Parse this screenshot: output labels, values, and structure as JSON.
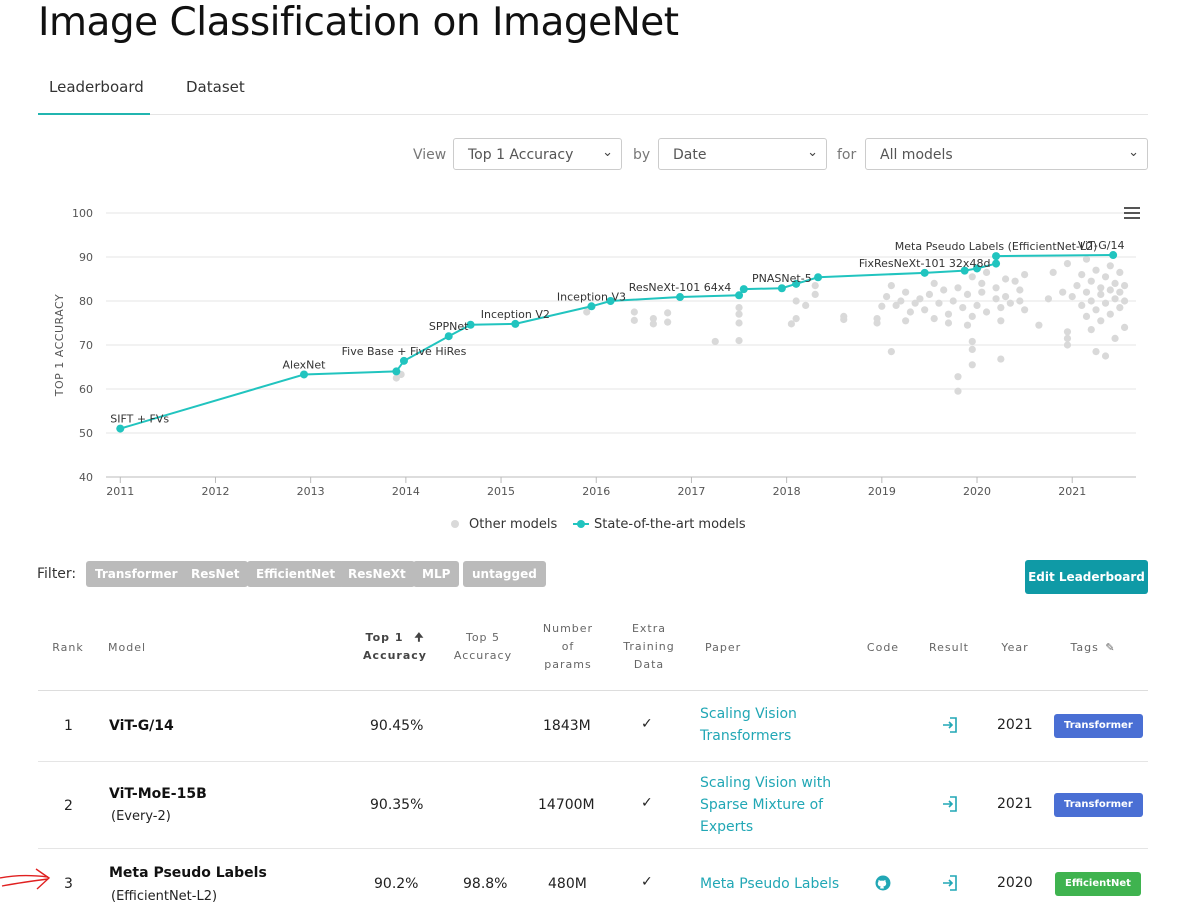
{
  "page": {
    "title": "Image Classification on ImageNet"
  },
  "tabs": [
    {
      "label": "Leaderboard"
    },
    {
      "label": "Dataset"
    }
  ],
  "viewbar": {
    "view_label": "View",
    "view_value": "Top 1 Accuracy",
    "by_label": "by",
    "by_value": "Date",
    "for_label": "for",
    "for_value": "All models"
  },
  "chart_data": {
    "type": "scatter",
    "ylabel": "TOP 1 ACCURACY",
    "ylim": [
      40,
      100
    ],
    "yticks": [
      "40",
      "50",
      "60",
      "70",
      "80",
      "90",
      "100"
    ],
    "xlim": [
      2010.85,
      2021.67
    ],
    "xticks": [
      "2011",
      "2012",
      "2013",
      "2014",
      "2015",
      "2016",
      "2017",
      "2018",
      "2019",
      "2020",
      "2021"
    ],
    "grid": true,
    "legend_placement": "bottom",
    "legend": [
      "Other models",
      "State-of-the-art models"
    ],
    "colors": {
      "sota": "#21c4bf",
      "other": "#d9d9d9"
    },
    "sota_series": {
      "name": "State-of-the-art models",
      "points": [
        {
          "x": 2011.0,
          "y": 51.0,
          "label": "SIFT + FVs"
        },
        {
          "x": 2012.93,
          "y": 63.3,
          "label": "AlexNet"
        },
        {
          "x": 2013.9,
          "y": 64.0,
          "label": ""
        },
        {
          "x": 2013.98,
          "y": 66.4,
          "label": "Five Base + Five HiRes"
        },
        {
          "x": 2014.45,
          "y": 72.0,
          "label": "SPPNet"
        },
        {
          "x": 2014.68,
          "y": 74.6,
          "label": ""
        },
        {
          "x": 2015.15,
          "y": 74.8,
          "label": "Inception V2"
        },
        {
          "x": 2015.95,
          "y": 78.8,
          "label": "Inception V3"
        },
        {
          "x": 2016.15,
          "y": 80.0,
          "label": ""
        },
        {
          "x": 2016.88,
          "y": 80.9,
          "label": "ResNeXt-101 64x4"
        },
        {
          "x": 2017.5,
          "y": 81.3,
          "label": ""
        },
        {
          "x": 2017.55,
          "y": 82.7,
          "label": ""
        },
        {
          "x": 2017.95,
          "y": 82.9,
          "label": "PNASNet-5"
        },
        {
          "x": 2018.1,
          "y": 83.9,
          "label": ""
        },
        {
          "x": 2018.33,
          "y": 85.4,
          "label": ""
        },
        {
          "x": 2019.45,
          "y": 86.4,
          "label": "FixResNeXt-101 32x48d"
        },
        {
          "x": 2019.87,
          "y": 86.9,
          "label": ""
        },
        {
          "x": 2020.0,
          "y": 87.4,
          "label": ""
        },
        {
          "x": 2020.2,
          "y": 88.5,
          "label": ""
        },
        {
          "x": 2020.2,
          "y": 90.2,
          "label": "Meta Pseudo Labels (EfficientNet-L2)"
        },
        {
          "x": 2021.43,
          "y": 90.45,
          "label": "ViT-G/14"
        }
      ]
    },
    "other_series": {
      "name": "Other models",
      "points": [
        [
          2013.9,
          62.5
        ],
        [
          2013.95,
          63.3
        ],
        [
          2015.9,
          77.5
        ],
        [
          2016.4,
          75.6
        ],
        [
          2016.4,
          77.5
        ],
        [
          2016.6,
          74.8
        ],
        [
          2016.6,
          76.0
        ],
        [
          2016.75,
          75.2
        ],
        [
          2016.75,
          77.3
        ],
        [
          2017.25,
          70.8
        ],
        [
          2017.5,
          71.0
        ],
        [
          2017.5,
          75.0
        ],
        [
          2017.5,
          77.0
        ],
        [
          2017.5,
          78.5
        ],
        [
          2018.05,
          74.8
        ],
        [
          2018.1,
          76.0
        ],
        [
          2018.1,
          80.0
        ],
        [
          2018.2,
          79.0
        ],
        [
          2018.3,
          81.5
        ],
        [
          2018.3,
          83.5
        ],
        [
          2018.6,
          75.8
        ],
        [
          2018.6,
          76.5
        ],
        [
          2018.95,
          75.0
        ],
        [
          2018.95,
          76.0
        ],
        [
          2019.0,
          78.8
        ],
        [
          2019.05,
          81.0
        ],
        [
          2019.1,
          83.5
        ],
        [
          2019.15,
          79.0
        ],
        [
          2019.1,
          68.5
        ],
        [
          2019.2,
          80.0
        ],
        [
          2019.25,
          75.5
        ],
        [
          2019.25,
          82.0
        ],
        [
          2019.3,
          77.5
        ],
        [
          2019.35,
          79.5
        ],
        [
          2019.4,
          80.5
        ],
        [
          2019.45,
          78.0
        ],
        [
          2019.5,
          81.5
        ],
        [
          2019.55,
          76.0
        ],
        [
          2019.55,
          84.0
        ],
        [
          2019.6,
          79.5
        ],
        [
          2019.65,
          82.5
        ],
        [
          2019.7,
          75.0
        ],
        [
          2019.7,
          77.0
        ],
        [
          2019.75,
          80.0
        ],
        [
          2019.8,
          83.0
        ],
        [
          2019.8,
          59.5
        ],
        [
          2019.8,
          62.8
        ],
        [
          2019.85,
          78.5
        ],
        [
          2019.9,
          81.5
        ],
        [
          2019.9,
          74.5
        ],
        [
          2019.95,
          76.5
        ],
        [
          2019.95,
          85.5
        ],
        [
          2019.95,
          69.0
        ],
        [
          2019.95,
          70.8
        ],
        [
          2019.95,
          65.5
        ],
        [
          2020.0,
          79.0
        ],
        [
          2020.05,
          82.0
        ],
        [
          2020.05,
          84.0
        ],
        [
          2020.1,
          77.5
        ],
        [
          2020.1,
          86.5
        ],
        [
          2020.2,
          80.5
        ],
        [
          2020.2,
          83.0
        ],
        [
          2020.25,
          78.5
        ],
        [
          2020.25,
          75.5
        ],
        [
          2020.25,
          66.8
        ],
        [
          2020.3,
          85.0
        ],
        [
          2020.3,
          81.0
        ],
        [
          2020.35,
          79.5
        ],
        [
          2020.4,
          84.5
        ],
        [
          2020.45,
          82.5
        ],
        [
          2020.45,
          80.0
        ],
        [
          2020.5,
          86.0
        ],
        [
          2020.5,
          78.0
        ],
        [
          2020.65,
          74.5
        ],
        [
          2020.75,
          80.5
        ],
        [
          2020.8,
          86.5
        ],
        [
          2020.9,
          82.0
        ],
        [
          2020.95,
          88.5
        ],
        [
          2020.95,
          71.5
        ],
        [
          2020.95,
          70.0
        ],
        [
          2020.95,
          73.0
        ],
        [
          2021.0,
          81.0
        ],
        [
          2021.05,
          83.5
        ],
        [
          2021.1,
          79.0
        ],
        [
          2021.1,
          86.0
        ],
        [
          2021.15,
          82.0
        ],
        [
          2021.15,
          76.5
        ],
        [
          2021.15,
          89.5
        ],
        [
          2021.2,
          80.0
        ],
        [
          2021.2,
          84.5
        ],
        [
          2021.2,
          73.5
        ],
        [
          2021.25,
          78.0
        ],
        [
          2021.25,
          87.0
        ],
        [
          2021.25,
          68.5
        ],
        [
          2021.3,
          81.5
        ],
        [
          2021.3,
          83.0
        ],
        [
          2021.3,
          75.5
        ],
        [
          2021.35,
          79.5
        ],
        [
          2021.35,
          85.5
        ],
        [
          2021.35,
          67.5
        ],
        [
          2021.4,
          82.5
        ],
        [
          2021.4,
          77.0
        ],
        [
          2021.4,
          88.0
        ],
        [
          2021.45,
          80.5
        ],
        [
          2021.45,
          84.0
        ],
        [
          2021.45,
          71.5
        ],
        [
          2021.5,
          78.5
        ],
        [
          2021.5,
          86.5
        ],
        [
          2021.5,
          82.0
        ],
        [
          2021.55,
          80.0
        ],
        [
          2021.55,
          74.0
        ],
        [
          2021.55,
          83.5
        ]
      ]
    }
  },
  "filter": {
    "label": "Filter:",
    "chips": [
      "Transformer",
      "ResNet",
      "EfficientNet",
      "ResNeXt",
      "MLP",
      "untagged"
    ]
  },
  "edit_button": "Edit Leaderboard",
  "table": {
    "headers": {
      "rank": "Rank",
      "model": "Model",
      "top1_a": "Top 1",
      "top1_b": "Accuracy",
      "top5_a": "Top 5",
      "top5_b": "Accuracy",
      "params_a": "Number",
      "params_b": "of",
      "params_c": "params",
      "extra_a": "Extra",
      "extra_b": "Training",
      "extra_c": "Data",
      "paper": "Paper",
      "code": "Code",
      "result": "Result",
      "year": "Year",
      "tags": "Tags"
    },
    "rows": [
      {
        "rank": "1",
        "model": "ViT-G/14",
        "model_sub": "",
        "top1": "90.45%",
        "top5": "",
        "params": "1843M",
        "extra": "✓",
        "paper": [
          "Scaling Vision",
          "Transformers"
        ],
        "year": "2021",
        "tag": "Transformer",
        "has_code": false
      },
      {
        "rank": "2",
        "model": "ViT-MoE-15B",
        "model_sub": "(Every-2)",
        "top1": "90.35%",
        "top5": "",
        "params": "14700M",
        "extra": "✓",
        "paper": [
          "Scaling Vision with",
          "Sparse Mixture of",
          "Experts"
        ],
        "year": "2021",
        "tag": "Transformer",
        "has_code": false
      },
      {
        "rank": "3",
        "model": "Meta Pseudo Labels",
        "model_sub": "(EfficientNet-L2)",
        "top1": "90.2%",
        "top5": "98.8%",
        "params": "480M",
        "extra": "✓",
        "paper": [
          "Meta Pseudo Labels"
        ],
        "year": "2020",
        "tag": "EfficientNet",
        "has_code": true
      }
    ]
  }
}
